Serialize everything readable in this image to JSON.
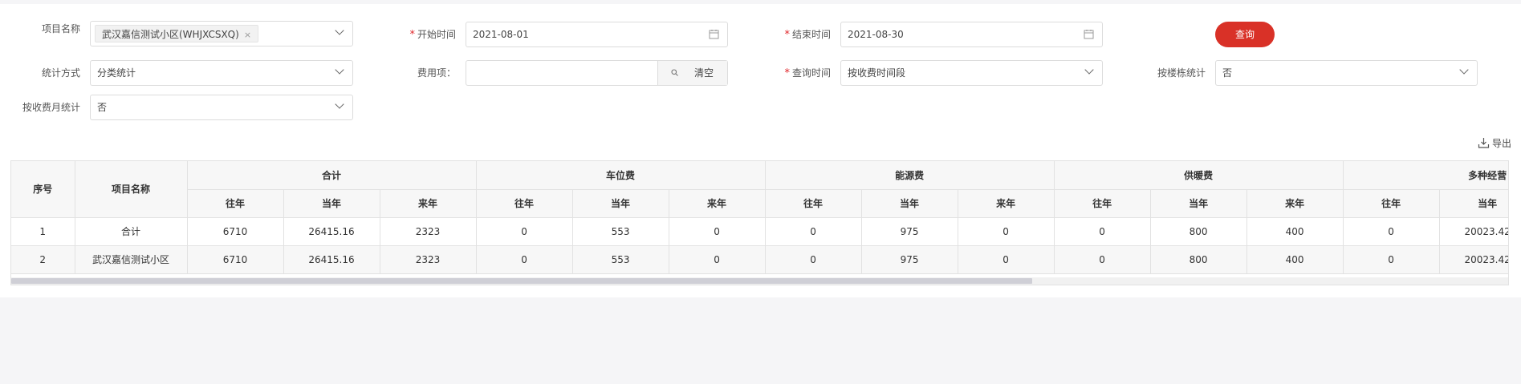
{
  "filters": {
    "project": {
      "label": "项目名称",
      "tag": "武汉嘉信测试小区(WHJXCSXQ)",
      "tag_close": "×"
    },
    "start": {
      "label": "开始时间",
      "value": "2021-08-01",
      "required_mark": "*"
    },
    "end": {
      "label": "结束时间",
      "value": "2021-08-30",
      "required_mark": "*"
    },
    "query_button": "查询",
    "stat_method": {
      "label": "统计方式",
      "value": "分类统计"
    },
    "fee_item": {
      "label": "费用项：",
      "value": "",
      "clear_label": "清空"
    },
    "query_time": {
      "label": "查询时间",
      "value": "按收费时间段",
      "required_mark": "*"
    },
    "by_building": {
      "label": "按楼栋统计",
      "value": "否"
    },
    "by_month": {
      "label": "按收费月统计",
      "value": "否"
    }
  },
  "export_label": "导出",
  "table": {
    "col_index": "序号",
    "col_project": "项目名称",
    "groups": [
      "合计",
      "车位费",
      "能源费",
      "供暖费",
      "多种经营"
    ],
    "subheaders": [
      "往年",
      "当年",
      "来年"
    ],
    "rows": [
      {
        "index": "1",
        "project": "合计",
        "cells": [
          "6710",
          "26415.16",
          "2323",
          "0",
          "553",
          "0",
          "0",
          "975",
          "0",
          "0",
          "800",
          "400",
          "0",
          "20023.42"
        ]
      },
      {
        "index": "2",
        "project": "武汉嘉信测试小区",
        "cells": [
          "6710",
          "26415.16",
          "2323",
          "0",
          "553",
          "0",
          "0",
          "975",
          "0",
          "0",
          "800",
          "400",
          "0",
          "20023.42"
        ]
      }
    ]
  },
  "colors": {
    "accent": "#d93127",
    "required": "#e0262a"
  }
}
